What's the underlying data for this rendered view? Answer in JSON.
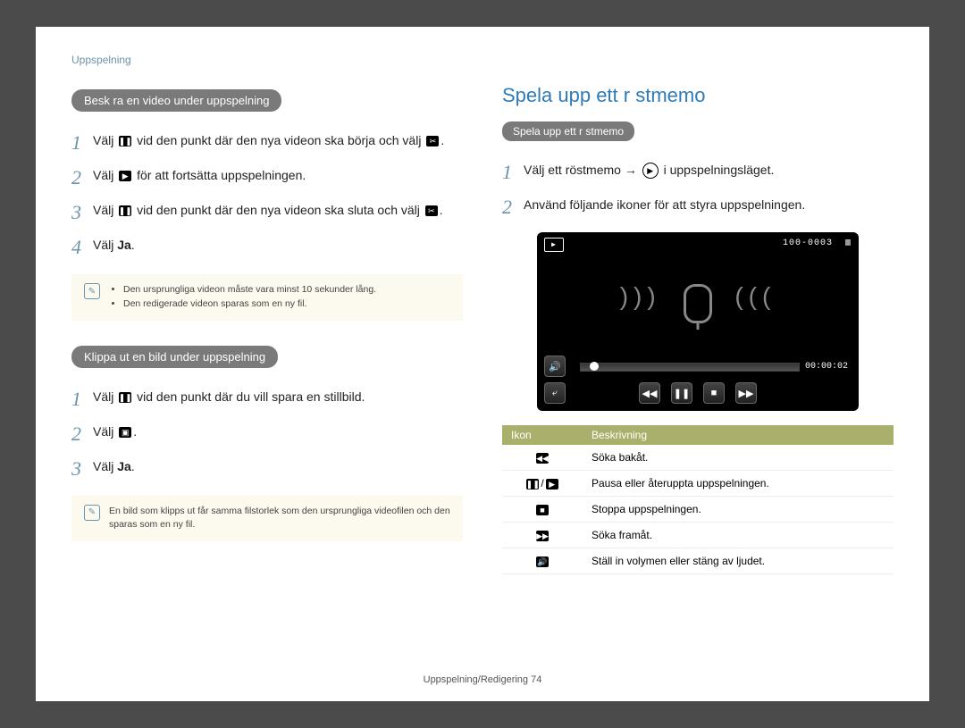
{
  "header": {
    "section": "Uppspelning"
  },
  "left": {
    "pill1": "Besk ra en video under uppspelning",
    "steps1": [
      "Välj [pause] vid den punkt där den nya videon ska börja och välj [cut].",
      "Välj [play] för att fortsätta uppspelningen.",
      "Välj [pause] vid den punkt där den nya videon ska sluta och välj [cut].",
      "Välj <b>Ja</b>."
    ],
    "note1": [
      "Den ursprungliga videon måste vara minst 10 sekunder lång.",
      "Den redigerade videon sparas som en ny fil."
    ],
    "pill2": "Klippa ut en bild under uppspelning",
    "steps2": [
      "Välj [pause] vid den punkt där du vill spara en stillbild.",
      "Välj [capture].",
      "Välj <b>Ja</b>."
    ],
    "note2": "En bild som klipps ut får samma filstorlek som den ursprungliga videofilen och den sparas som en ny fil."
  },
  "right": {
    "title": "Spela upp ett r stmemo",
    "pill": "Spela upp ett r stmemo",
    "steps": [
      "Välj ett röstmemo → [play] i uppspelningsläget.",
      "Använd följande ikoner för att styra uppspelningen."
    ],
    "player": {
      "file": "100-0003",
      "time": "00:00:02"
    },
    "table": {
      "head": [
        "Ikon",
        "Beskrivning"
      ],
      "rows": [
        {
          "icon": "rewind",
          "desc": "Söka bakåt."
        },
        {
          "icon": "pauseplay",
          "desc": "Pausa eller återuppta uppspelningen."
        },
        {
          "icon": "stop",
          "desc": "Stoppa uppspelningen."
        },
        {
          "icon": "forward",
          "desc": "Söka framåt."
        },
        {
          "icon": "volume",
          "desc": "Ställ in volymen eller stäng av ljudet."
        }
      ]
    }
  },
  "footer": {
    "text": "Uppspelning/Redigering",
    "page": "74"
  }
}
